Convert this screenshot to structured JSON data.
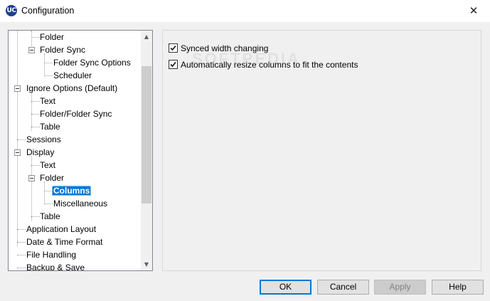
{
  "window": {
    "title": "Configuration"
  },
  "icons": {
    "app": "app-icon",
    "close": "close-icon"
  },
  "app_icon_text": "UC",
  "tree": {
    "items": [
      {
        "label": "Folder",
        "level": 1,
        "selected": false
      },
      {
        "label": "Folder Sync",
        "level": 1,
        "selected": false
      },
      {
        "label": "Folder Sync Options",
        "level": 2,
        "selected": false
      },
      {
        "label": "Scheduler",
        "level": 2,
        "selected": false
      },
      {
        "label": "Ignore Options (Default)",
        "level": 0,
        "selected": false
      },
      {
        "label": "Text",
        "level": 1,
        "selected": false
      },
      {
        "label": "Folder/Folder Sync",
        "level": 1,
        "selected": false
      },
      {
        "label": "Table",
        "level": 1,
        "selected": false
      },
      {
        "label": "Sessions",
        "level": 0,
        "selected": false
      },
      {
        "label": "Display",
        "level": 0,
        "selected": false
      },
      {
        "label": "Text",
        "level": 1,
        "selected": false
      },
      {
        "label": "Folder",
        "level": 1,
        "selected": false
      },
      {
        "label": "Columns",
        "level": 2,
        "selected": true
      },
      {
        "label": "Miscellaneous",
        "level": 2,
        "selected": false
      },
      {
        "label": "Table",
        "level": 1,
        "selected": false
      },
      {
        "label": "Application Layout",
        "level": 0,
        "selected": false
      },
      {
        "label": "Date & Time Format",
        "level": 0,
        "selected": false
      },
      {
        "label": "File Handling",
        "level": 0,
        "selected": false
      },
      {
        "label": "Backup & Save",
        "level": 0,
        "selected": false
      }
    ]
  },
  "options": {
    "synced_width": {
      "label": "Synced width changing",
      "checked": true
    },
    "auto_resize": {
      "label": "Automatically resize columns to fit the contents",
      "checked": true
    }
  },
  "watermark": "SOFTPEDIA",
  "buttons": {
    "ok": "OK",
    "cancel": "Cancel",
    "apply": "Apply",
    "help": "Help"
  },
  "colors": {
    "selection": "#0078d7",
    "default_button_border": "#0078d7"
  }
}
